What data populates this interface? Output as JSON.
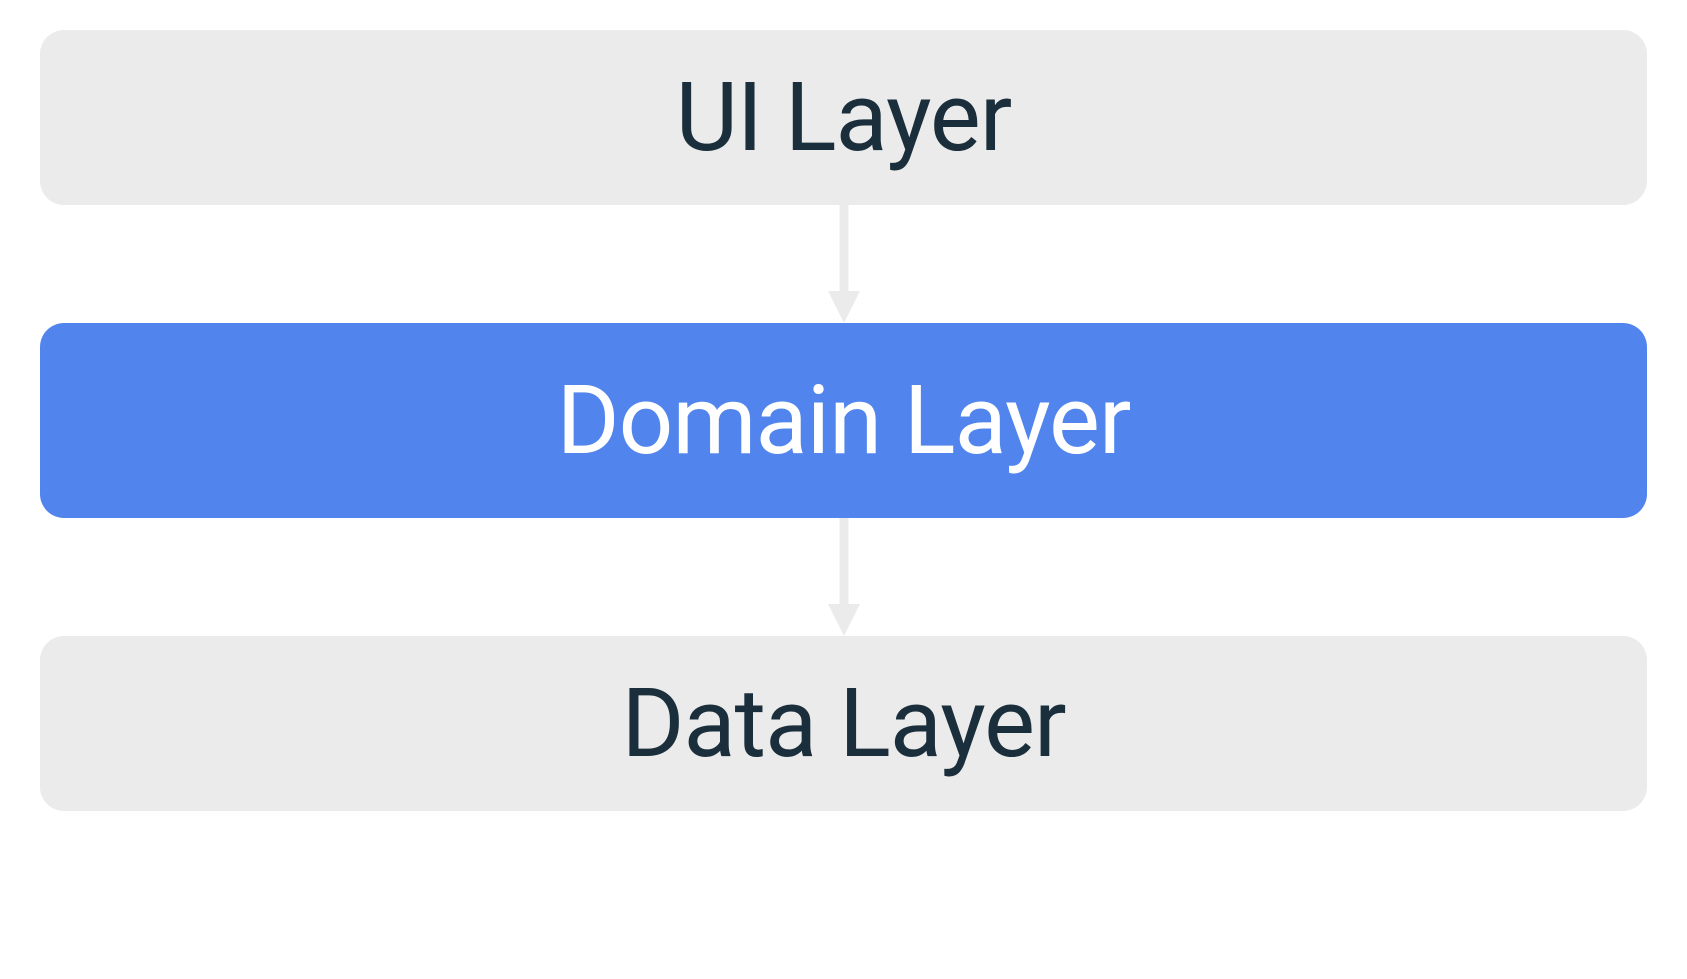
{
  "layers": {
    "top": {
      "label": "UI Layer"
    },
    "middle": {
      "label": "Domain Layer"
    },
    "bottom": {
      "label": "Data Layer"
    }
  },
  "colors": {
    "gray_bg": "#ebebeb",
    "blue_bg": "#5185ed",
    "dark_text": "#1a2e3b",
    "white_text": "#ffffff",
    "arrow": "#ebebeb"
  }
}
